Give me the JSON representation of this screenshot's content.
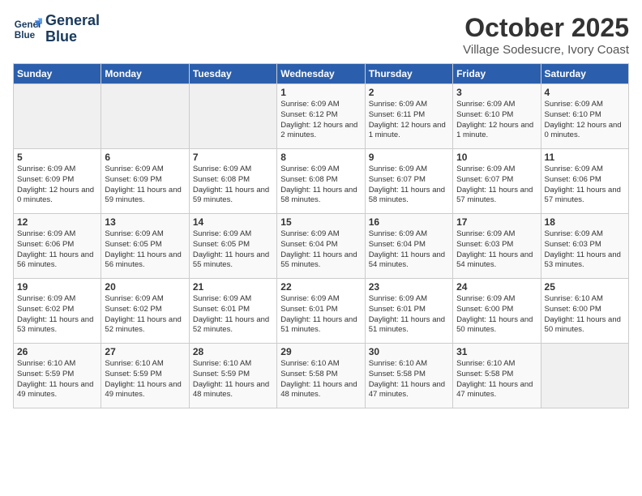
{
  "header": {
    "logo_line1": "General",
    "logo_line2": "Blue",
    "month_title": "October 2025",
    "subtitle": "Village Sodesucre, Ivory Coast"
  },
  "weekdays": [
    "Sunday",
    "Monday",
    "Tuesday",
    "Wednesday",
    "Thursday",
    "Friday",
    "Saturday"
  ],
  "weeks": [
    [
      {
        "day": "",
        "info": ""
      },
      {
        "day": "",
        "info": ""
      },
      {
        "day": "",
        "info": ""
      },
      {
        "day": "1",
        "info": "Sunrise: 6:09 AM\nSunset: 6:12 PM\nDaylight: 12 hours and 2 minutes."
      },
      {
        "day": "2",
        "info": "Sunrise: 6:09 AM\nSunset: 6:11 PM\nDaylight: 12 hours and 1 minute."
      },
      {
        "day": "3",
        "info": "Sunrise: 6:09 AM\nSunset: 6:10 PM\nDaylight: 12 hours and 1 minute."
      },
      {
        "day": "4",
        "info": "Sunrise: 6:09 AM\nSunset: 6:10 PM\nDaylight: 12 hours and 0 minutes."
      }
    ],
    [
      {
        "day": "5",
        "info": "Sunrise: 6:09 AM\nSunset: 6:09 PM\nDaylight: 12 hours and 0 minutes."
      },
      {
        "day": "6",
        "info": "Sunrise: 6:09 AM\nSunset: 6:09 PM\nDaylight: 11 hours and 59 minutes."
      },
      {
        "day": "7",
        "info": "Sunrise: 6:09 AM\nSunset: 6:08 PM\nDaylight: 11 hours and 59 minutes."
      },
      {
        "day": "8",
        "info": "Sunrise: 6:09 AM\nSunset: 6:08 PM\nDaylight: 11 hours and 58 minutes."
      },
      {
        "day": "9",
        "info": "Sunrise: 6:09 AM\nSunset: 6:07 PM\nDaylight: 11 hours and 58 minutes."
      },
      {
        "day": "10",
        "info": "Sunrise: 6:09 AM\nSunset: 6:07 PM\nDaylight: 11 hours and 57 minutes."
      },
      {
        "day": "11",
        "info": "Sunrise: 6:09 AM\nSunset: 6:06 PM\nDaylight: 11 hours and 57 minutes."
      }
    ],
    [
      {
        "day": "12",
        "info": "Sunrise: 6:09 AM\nSunset: 6:06 PM\nDaylight: 11 hours and 56 minutes."
      },
      {
        "day": "13",
        "info": "Sunrise: 6:09 AM\nSunset: 6:05 PM\nDaylight: 11 hours and 56 minutes."
      },
      {
        "day": "14",
        "info": "Sunrise: 6:09 AM\nSunset: 6:05 PM\nDaylight: 11 hours and 55 minutes."
      },
      {
        "day": "15",
        "info": "Sunrise: 6:09 AM\nSunset: 6:04 PM\nDaylight: 11 hours and 55 minutes."
      },
      {
        "day": "16",
        "info": "Sunrise: 6:09 AM\nSunset: 6:04 PM\nDaylight: 11 hours and 54 minutes."
      },
      {
        "day": "17",
        "info": "Sunrise: 6:09 AM\nSunset: 6:03 PM\nDaylight: 11 hours and 54 minutes."
      },
      {
        "day": "18",
        "info": "Sunrise: 6:09 AM\nSunset: 6:03 PM\nDaylight: 11 hours and 53 minutes."
      }
    ],
    [
      {
        "day": "19",
        "info": "Sunrise: 6:09 AM\nSunset: 6:02 PM\nDaylight: 11 hours and 53 minutes."
      },
      {
        "day": "20",
        "info": "Sunrise: 6:09 AM\nSunset: 6:02 PM\nDaylight: 11 hours and 52 minutes."
      },
      {
        "day": "21",
        "info": "Sunrise: 6:09 AM\nSunset: 6:01 PM\nDaylight: 11 hours and 52 minutes."
      },
      {
        "day": "22",
        "info": "Sunrise: 6:09 AM\nSunset: 6:01 PM\nDaylight: 11 hours and 51 minutes."
      },
      {
        "day": "23",
        "info": "Sunrise: 6:09 AM\nSunset: 6:01 PM\nDaylight: 11 hours and 51 minutes."
      },
      {
        "day": "24",
        "info": "Sunrise: 6:09 AM\nSunset: 6:00 PM\nDaylight: 11 hours and 50 minutes."
      },
      {
        "day": "25",
        "info": "Sunrise: 6:10 AM\nSunset: 6:00 PM\nDaylight: 11 hours and 50 minutes."
      }
    ],
    [
      {
        "day": "26",
        "info": "Sunrise: 6:10 AM\nSunset: 5:59 PM\nDaylight: 11 hours and 49 minutes."
      },
      {
        "day": "27",
        "info": "Sunrise: 6:10 AM\nSunset: 5:59 PM\nDaylight: 11 hours and 49 minutes."
      },
      {
        "day": "28",
        "info": "Sunrise: 6:10 AM\nSunset: 5:59 PM\nDaylight: 11 hours and 48 minutes."
      },
      {
        "day": "29",
        "info": "Sunrise: 6:10 AM\nSunset: 5:58 PM\nDaylight: 11 hours and 48 minutes."
      },
      {
        "day": "30",
        "info": "Sunrise: 6:10 AM\nSunset: 5:58 PM\nDaylight: 11 hours and 47 minutes."
      },
      {
        "day": "31",
        "info": "Sunrise: 6:10 AM\nSunset: 5:58 PM\nDaylight: 11 hours and 47 minutes."
      },
      {
        "day": "",
        "info": ""
      }
    ]
  ]
}
